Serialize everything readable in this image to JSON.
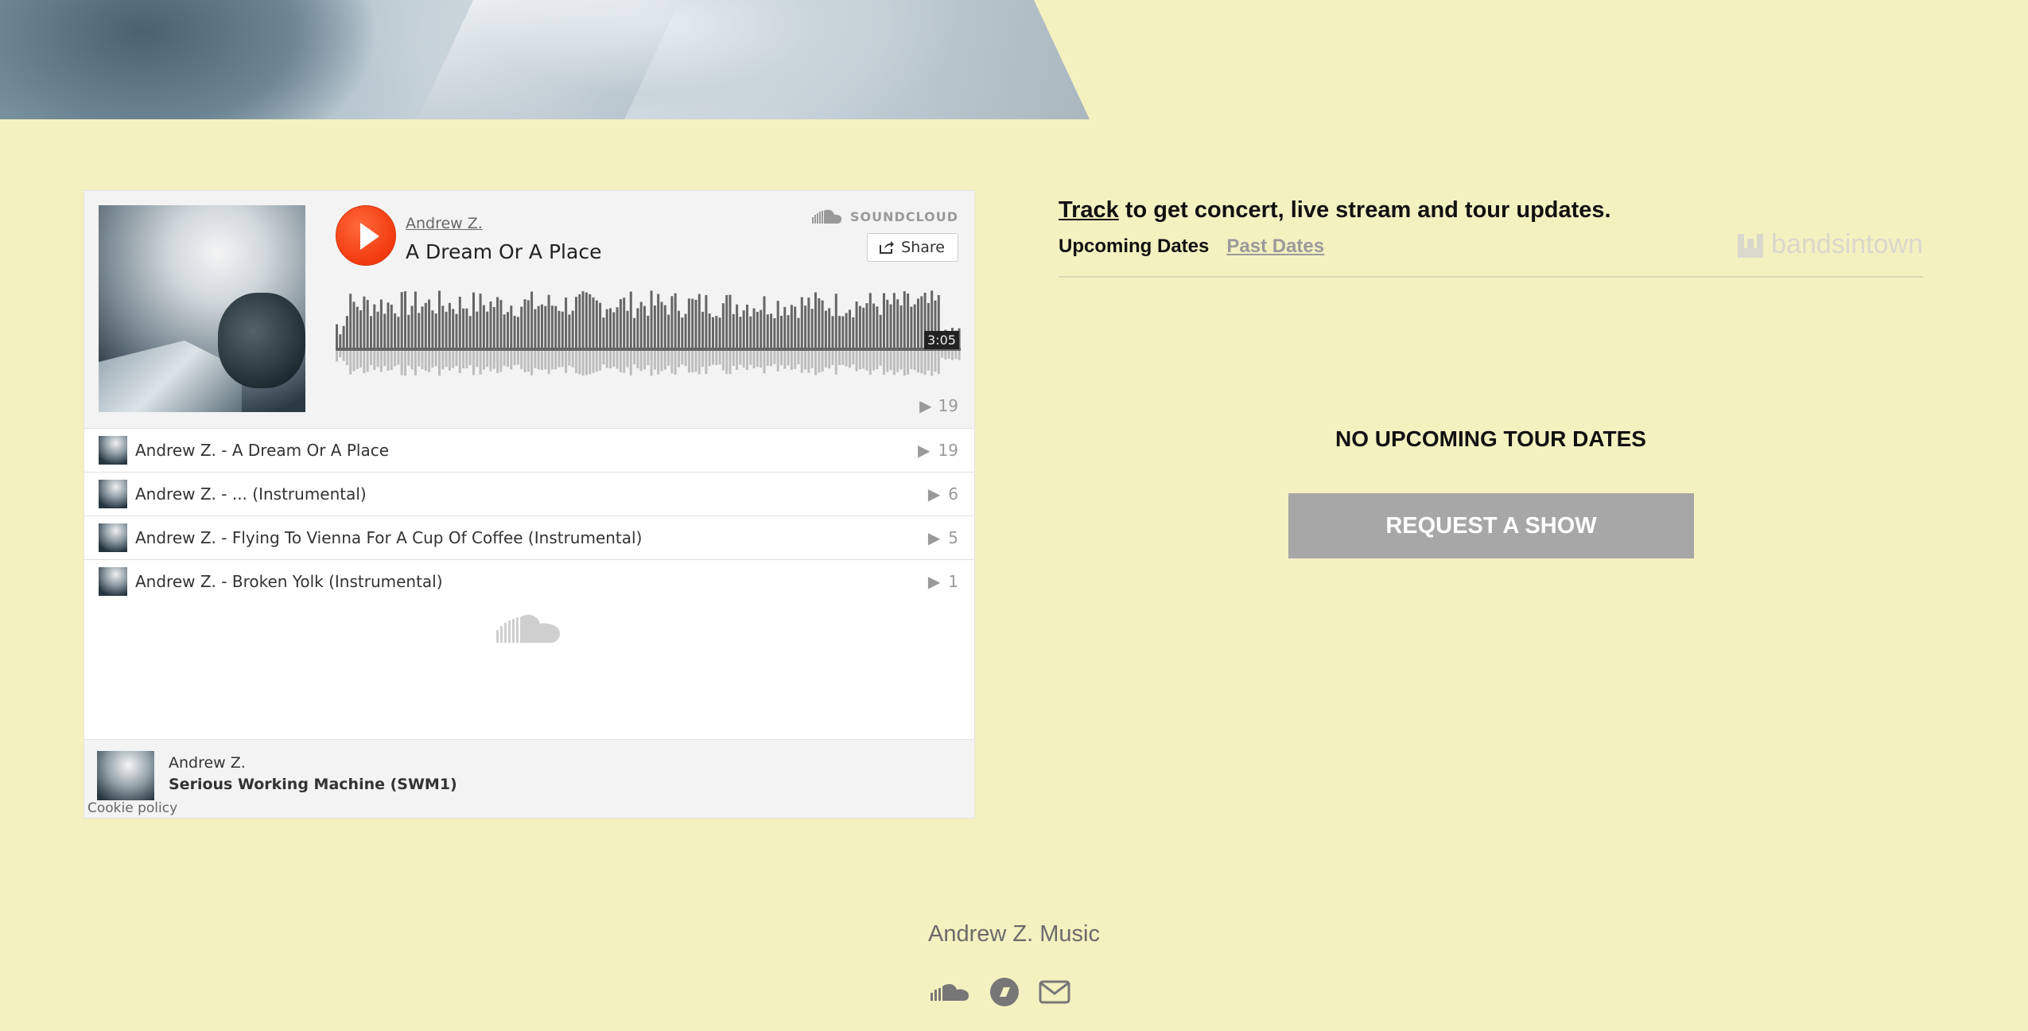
{
  "soundcloud": {
    "brand": "SOUNDCLOUD",
    "artist": "Andrew Z.",
    "current_track": "A Dream Or A Place",
    "share_label": "Share",
    "duration": "3:05",
    "main_plays": "19",
    "tracks": [
      {
        "title": "Andrew Z. - A Dream Or A Place",
        "plays": "19"
      },
      {
        "title": "Andrew Z. - ... (Instrumental)",
        "plays": "6"
      },
      {
        "title": "Andrew Z. - Flying To Vienna For A Cup Of Coffee (Instrumental)",
        "plays": "5"
      },
      {
        "title": "Andrew Z. - Broken Yolk (Instrumental)",
        "plays": "1"
      }
    ],
    "footer": {
      "user": "Andrew Z.",
      "set_title": "Serious Working Machine (SWM1)"
    },
    "cookie_policy": "Cookie policy",
    "accent_color": "#f43c10"
  },
  "bandsintown": {
    "track_link": "Track",
    "track_text": " to get concert, live stream and tour updates.",
    "tab_upcoming": "Upcoming Dates",
    "tab_past": "Past Dates",
    "logo_text": "bandsintown",
    "no_dates": "NO UPCOMING TOUR DATES",
    "request_button": "REQUEST A SHOW"
  },
  "footer": {
    "site_name": "Andrew Z. Music",
    "social_icons": [
      "soundcloud-icon",
      "bandcamp-icon",
      "email-icon"
    ]
  }
}
